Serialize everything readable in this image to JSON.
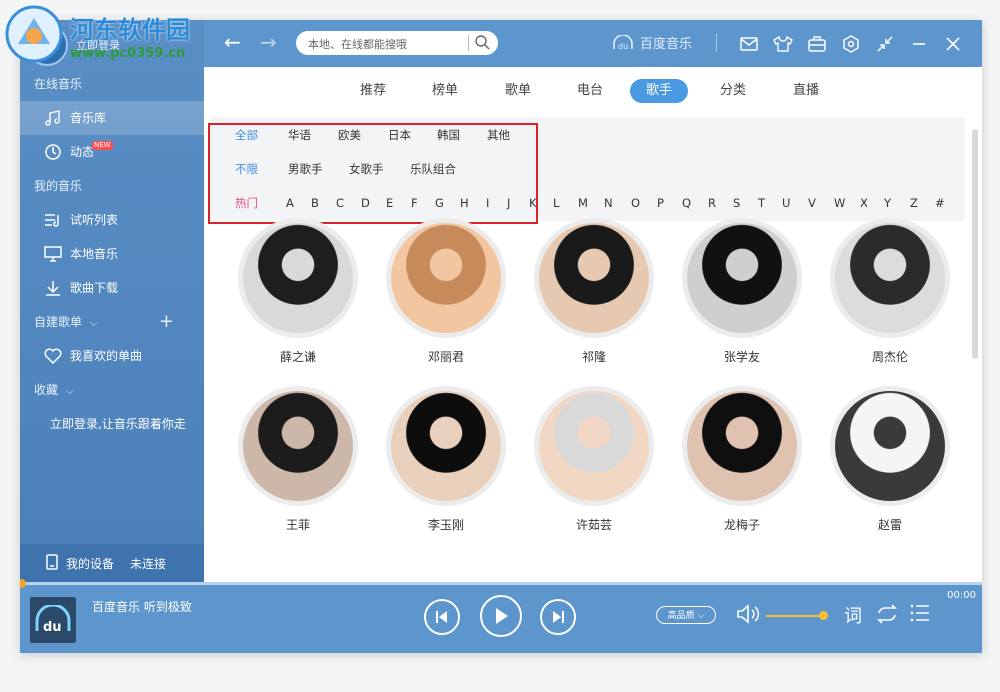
{
  "watermark": {
    "title": "河东软件园",
    "url": "www.pc0359.cn"
  },
  "sidebar": {
    "login_top": "立即登录",
    "online_music": "在线音乐",
    "items_online": [
      {
        "label": "音乐库",
        "icon": "music-note-icon"
      },
      {
        "label": "动态",
        "icon": "activity-icon",
        "badge": "NEW"
      }
    ],
    "my_music": "我的音乐",
    "items_mine": [
      {
        "label": "试听列表",
        "icon": "playlist-icon"
      },
      {
        "label": "本地音乐",
        "icon": "monitor-icon"
      },
      {
        "label": "歌曲下载",
        "icon": "download-icon"
      }
    ],
    "custom_playlist": "自建歌单",
    "favorite": "我喜欢的单曲",
    "collection": "收藏",
    "login_hint": "立即登录,让音乐跟着你走",
    "device": {
      "label": "我的设备",
      "status": "未连接"
    }
  },
  "topbar": {
    "search_placeholder": "本地、在线都能搜哦",
    "brand": "百度音乐"
  },
  "tabs": [
    "推荐",
    "榜单",
    "歌单",
    "电台",
    "歌手",
    "分类",
    "直播"
  ],
  "active_tab": "歌手",
  "filters": {
    "region": [
      "全部",
      "华语",
      "欧美",
      "日本",
      "韩国",
      "其他"
    ],
    "gender": [
      "不限",
      "男歌手",
      "女歌手",
      "乐队组合"
    ],
    "letters": [
      "热门",
      "A",
      "B",
      "C",
      "D",
      "E",
      "F",
      "G",
      "H",
      "I",
      "J",
      "K",
      "L",
      "M",
      "N",
      "O",
      "P",
      "Q",
      "R",
      "S",
      "T",
      "U",
      "V",
      "W",
      "X",
      "Y",
      "Z",
      "#"
    ]
  },
  "artists": [
    "薛之谦",
    "邓丽君",
    "祁隆",
    "张学友",
    "周杰伦",
    "王菲",
    "李玉刚",
    "许茹芸",
    "龙梅子",
    "赵雷"
  ],
  "player": {
    "song": "百度音乐 听到极致",
    "quality": "高品质",
    "lyrics_label": "词",
    "time": "00:00",
    "progress": 0
  },
  "colors": {
    "accent": "#4a9ae3",
    "sidebar": "#4b7fb8",
    "highlight_box": "#d8232a",
    "hot": "#e8507a"
  }
}
